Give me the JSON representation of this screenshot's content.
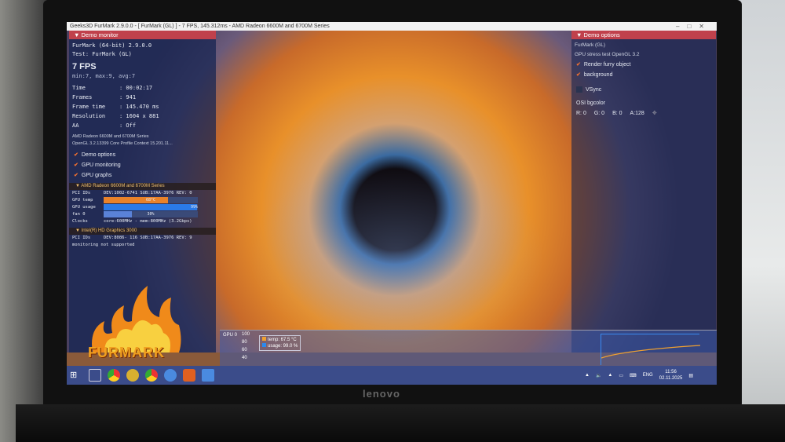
{
  "window": {
    "title": "Geeks3D FurMark 2.9.0.0 - [ FurMark (GL) ] - 7 FPS, 145.312ms - AMD Radeon 6600M and 6700M Series",
    "controls": [
      "–",
      "□",
      "✕"
    ]
  },
  "monitor": {
    "header": "Demo monitor",
    "app": "FurMark (64-bit) 2.9.0.0",
    "test": "Test: FurMark (GL)",
    "fps": "7 FPS",
    "fps_stats": "min:7, max:9, avg:7",
    "stats": [
      {
        "k": "Time",
        "v": ": 00:02:17"
      },
      {
        "k": "Frames",
        "v": ": 941"
      },
      {
        "k": "Frame time",
        "v": ": 145.470 ms"
      },
      {
        "k": "Resolution",
        "v": ": 1604 x 881"
      },
      {
        "k": "AA",
        "v": ": Off"
      }
    ],
    "gpu_name": "AMD Radeon 6600M and 6700M Series",
    "opengl": "OpenGL 3.2.13399 Core Profile Context 15.201.11...",
    "checks": [
      "Demo options",
      "GPU monitoring",
      "GPU graphs"
    ]
  },
  "gpu0": {
    "header": "AMD Radeon 6600M and 6700M Series",
    "pci_label": "PCI IDs",
    "pci": "DEV:1002-6741 SUB:17AA-3976 REV: 0",
    "temp_label": "GPU temp",
    "temp": "68°C",
    "temp_pct": 68,
    "usage_label": "GPU usage",
    "usage": "99%",
    "usage_pct": 99,
    "fan_label": "fan 0",
    "fan": "30%",
    "fan_pct": 30,
    "clocks_label": "Clocks",
    "clocks": "core:600MHz - mem:800MHz (3.2Gbps)"
  },
  "gpu1": {
    "header": "Intel(R) HD Graphics 3000",
    "pci_label": "PCI IDs",
    "pci": "DEV:8086- 116 SUB:17AA-3976 REV: 9",
    "note": "monitoring not supported"
  },
  "logo": "FURMARK",
  "options": {
    "header": "Demo options",
    "line1": "FurMark (GL)",
    "line2": "GPU stress test   OpenGL 3.2",
    "render": "Render furry object",
    "background": "background",
    "vsync": "VSync",
    "osi": "OSI bgcolor",
    "r": "R: 0",
    "g": "G: 0",
    "b": "B: 0",
    "a": "A:128"
  },
  "graph": {
    "label": "GPU 0",
    "yticks": [
      "100",
      "80",
      "60",
      "40"
    ],
    "temp": "temp: 67.5 °C",
    "usage": "usage: 99.0 %",
    "temp_color": "#f0a030",
    "usage_color": "#2a8af0"
  },
  "taskbar": {
    "lang": "ENG",
    "time": "11:56",
    "date": "02.11.2025"
  },
  "brand": "lenovo"
}
